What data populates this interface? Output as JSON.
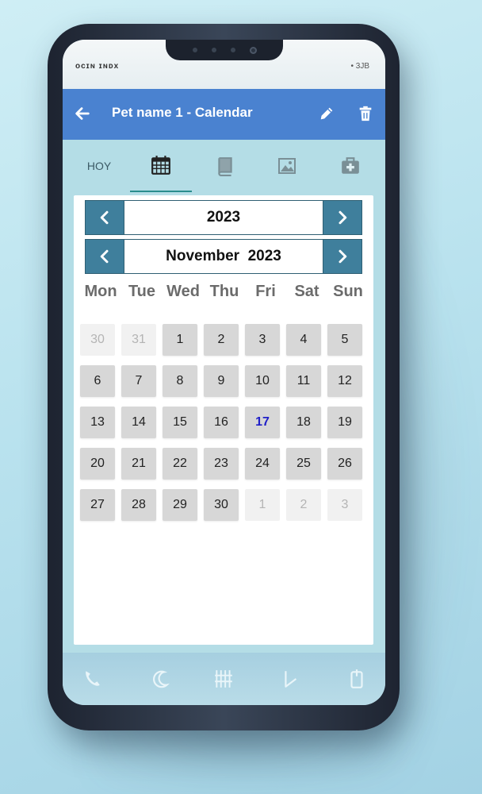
{
  "statusbar": {
    "left": "ᴏᴄɪɴ ɪɴᴅx",
    "right": "• 3JB"
  },
  "appbar": {
    "title": "Pet name 1 - Calendar"
  },
  "tabs": {
    "hoy": "HOY"
  },
  "calendar": {
    "year_label": "2023",
    "month_label": "November  2023",
    "weekdays": [
      "Mon",
      "Tue",
      "Wed",
      "Thu",
      "Fri",
      "Sat",
      "Sun"
    ],
    "weeks": [
      [
        "30",
        "31",
        "1",
        "2",
        "3",
        "4",
        "5"
      ],
      [
        "6",
        "7",
        "8",
        "9",
        "10",
        "11",
        "12"
      ],
      [
        "13",
        "14",
        "15",
        "16",
        "17",
        "18",
        "19"
      ],
      [
        "20",
        "21",
        "22",
        "23",
        "24",
        "25",
        "26"
      ],
      [
        "27",
        "28",
        "29",
        "30",
        "1",
        "2",
        "3"
      ]
    ]
  },
  "colors": {
    "appbar": "#4a82d0",
    "nav_button": "#3f7f9c",
    "today_text": "#2020c8",
    "tab_indicator": "#2a8d8d"
  },
  "icons": {
    "back": "arrow-left-icon",
    "edit": "pencil-icon",
    "delete": "trash-icon",
    "calendar_tab": "calendar-icon",
    "book_tab": "book-icon",
    "image_tab": "image-icon",
    "medical_tab": "medical-kit-icon"
  }
}
